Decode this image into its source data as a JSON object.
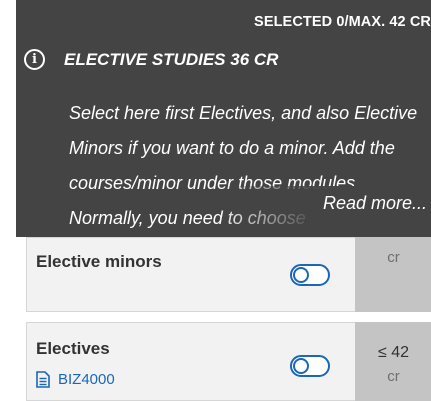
{
  "header": {
    "selected_count": "SELECTED 0/MAX. 42 CR",
    "title": "ELECTIVE STUDIES 36 CR",
    "info_icon_glyph": "i",
    "description": "Select here first Electives, and also Elective Minors if you want to do a minor. Add the courses/minor under those modules. Normally, you need to choose",
    "read_more_label": "Read more...",
    "background_color": "#444444"
  },
  "modules": [
    {
      "name": "Elective minors",
      "toggle_on": false,
      "credits_value": "",
      "credits_unit": "cr"
    },
    {
      "name": "Electives",
      "toggle_on": false,
      "course_code": "BIZ4000",
      "course_icon": "document-icon",
      "credits_value": "≤ 42",
      "credits_unit": "cr"
    }
  ],
  "colors": {
    "accent": "#1a67b8",
    "row_background": "#f2f2f2",
    "credit_box_background": "#c4c4c4"
  }
}
